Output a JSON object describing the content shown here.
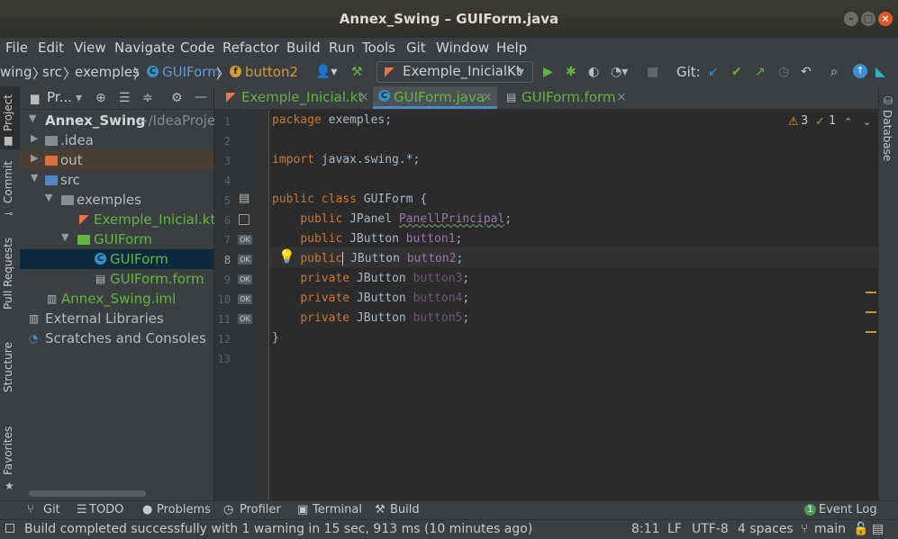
{
  "window": {
    "title": "Annex_Swing – GUIForm.java"
  },
  "menu": [
    "File",
    "Edit",
    "View",
    "Navigate",
    "Code",
    "Refactor",
    "Build",
    "Run",
    "Tools",
    "Git",
    "Window",
    "Help"
  ],
  "breadcrumb": [
    "wing",
    "src",
    "exemples",
    "GUIForm",
    "button2"
  ],
  "run_config": "Exemple_InicialKt",
  "git_label": "Git:",
  "left_strip": [
    "Project",
    "Commit",
    "Pull Requests",
    "Structure",
    "Favorites"
  ],
  "right_strip": [
    "Database"
  ],
  "project_panel": {
    "header": "Pr...",
    "tree": [
      {
        "label": "Annex_Swing",
        "suffix": "~/IdeaProjec",
        "level": 0,
        "kind": "module"
      },
      {
        "label": ".idea",
        "level": 1,
        "kind": "folder"
      },
      {
        "label": "out",
        "level": 1,
        "kind": "folder-orange"
      },
      {
        "label": "src",
        "level": 1,
        "kind": "folder-blue"
      },
      {
        "label": "exemples",
        "level": 2,
        "kind": "package"
      },
      {
        "label": "Exemple_Inicial.kt",
        "level": 3,
        "kind": "kotlin"
      },
      {
        "label": "GUIForm",
        "level": 3,
        "kind": "form-folder"
      },
      {
        "label": "GUIForm",
        "level": 4,
        "kind": "class"
      },
      {
        "label": "GUIForm.form",
        "level": 4,
        "kind": "form"
      },
      {
        "label": "Annex_Swing.iml",
        "level": 1,
        "kind": "iml"
      },
      {
        "label": "External Libraries",
        "level": 0,
        "kind": "libs"
      },
      {
        "label": "Scratches and Consoles",
        "level": 0,
        "kind": "scratch"
      }
    ]
  },
  "tabs": [
    {
      "label": "Exemple_Inicial.kt",
      "active": false
    },
    {
      "label": "GUIForm.java",
      "active": true
    },
    {
      "label": "GUIForm.form",
      "active": false
    }
  ],
  "inspections": {
    "warnings": "3",
    "ok": "1"
  },
  "code": {
    "line_numbers": [
      "1",
      "2",
      "3",
      "4",
      "5",
      "6",
      "7",
      "8",
      "9",
      "10",
      "11",
      "12",
      "13"
    ],
    "l1_kw": "package",
    "l1_rest": " exemples;",
    "l3_kw": "import",
    "l3_rest": " javax.swing.*;",
    "l5_kw": "public class",
    "l5_rest": " GUIForm {",
    "l6_kw": "public",
    "l6_type": " JPanel ",
    "l6_field": "PanellPrincipal",
    "l6_end": ";",
    "l7_kw": "public",
    "l7_type": " JButton ",
    "l7_field": "button1",
    "l7_end": ";",
    "l8_kw": "public",
    "l8_type": " JButton ",
    "l8_field": "button2",
    "l8_end": ";",
    "l9_kw": "private",
    "l9_type": " JButton ",
    "l9_field": "button3",
    "l9_end": ";",
    "l10_kw": "private",
    "l10_type": " JButton ",
    "l10_field": "button4",
    "l10_end": ";",
    "l11_kw": "private",
    "l11_type": " JButton ",
    "l11_field": "button5",
    "l11_end": ";",
    "l12": "}"
  },
  "gutter_badge": "OK",
  "bottom_tools": [
    "Git",
    "TODO",
    "Problems",
    "Profiler",
    "Terminal",
    "Build"
  ],
  "event_log": {
    "count": "1",
    "label": "Event Log"
  },
  "status": {
    "message": "Build completed successfully with 1 warning in 15 sec, 913 ms (10 minutes ago)",
    "position": "8:11",
    "line_sep": "LF",
    "encoding": "UTF-8",
    "indent": "4 spaces",
    "branch": "main"
  },
  "colors": {
    "accent": "#4a88c7",
    "keyword": "#cc7832",
    "field": "#9876aa",
    "green": "#62b543",
    "orange": "#e8754a"
  }
}
